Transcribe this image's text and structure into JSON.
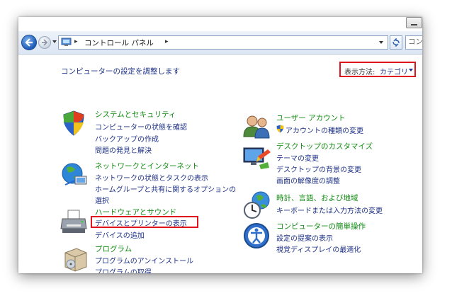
{
  "address_bar": {
    "breadcrumb": "コントロール パネル",
    "search_placeholder": "コン"
  },
  "header": {
    "title": "コンピューターの設定を調整します",
    "view_by_label": "表示方法:",
    "view_by_value": "カテゴリ"
  },
  "categories": [
    {
      "title": "システムとセキュリティ",
      "links": [
        "コンピューターの状態を確認",
        "バックアップの作成",
        "問題の発見と解決"
      ]
    },
    {
      "title": "ネットワークとインターネット",
      "links": [
        "ネットワークの状態とタスクの表示",
        "ホームグループと共有に関するオプションの",
        "選択"
      ]
    },
    {
      "title": "ハードウェアとサウンド",
      "links": [
        "デバイスとプリンターの表示",
        "デバイスの追加"
      ]
    },
    {
      "title": "プログラム",
      "links": [
        "プログラムのアンインストール",
        "プログラムの取得"
      ]
    },
    {
      "title": "ユーザー アカウント",
      "links": [
        "アカウントの種類の変更"
      ]
    },
    {
      "title": "デスクトップのカスタマイズ",
      "links": [
        "テーマの変更",
        "デスクトップの背景の変更",
        "画面の解像度の調整"
      ]
    },
    {
      "title": "時計、言語、および地域",
      "links": [
        "キーボードまたは入力方法の変更"
      ]
    },
    {
      "title": "コンピューターの簡単操作",
      "links": [
        "設定の提案の表示",
        "視覚ディスプレイの最適化"
      ]
    }
  ],
  "icons": {
    "back": "back-arrow-icon",
    "forward": "forward-arrow-icon",
    "control_panel": "control-panel-icon",
    "refresh": "refresh-icon",
    "system_security": "shield-icon",
    "network": "globe-network-icon",
    "hardware": "printer-icon",
    "programs": "programs-box-icon",
    "user_accounts": "users-icon",
    "uac_shield": "uac-shield-icon",
    "appearance": "desktop-appearance-icon",
    "clock_region": "clock-globe-icon",
    "ease_of_access": "ease-of-access-icon"
  },
  "colors": {
    "category_title": "#0f8a10",
    "link": "#1e3287",
    "highlight": "#e0141c"
  }
}
